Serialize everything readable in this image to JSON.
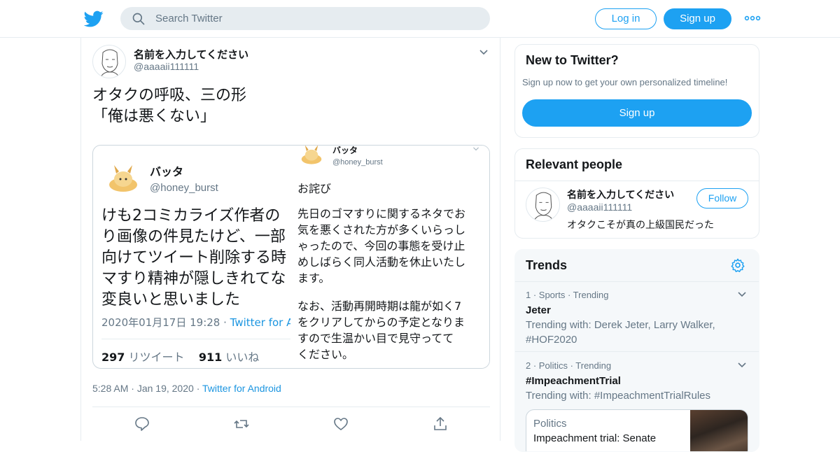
{
  "header": {
    "search_placeholder": "Search Twitter",
    "login_label": "Log in",
    "signup_label": "Sign up",
    "brand_color": "#1da1f2"
  },
  "tweet": {
    "name": "名前を入力してください",
    "handle": "@aaaaii111111",
    "text": "オタクの呼吸、三の形\n「俺は悪くない」",
    "time": "5:28 AM",
    "date": "Jan 19, 2020",
    "source": "Twitter for Android",
    "sep": "·"
  },
  "embedded": {
    "left": {
      "name": "バッタ",
      "handle": "@honey_burst",
      "body": "けも2コミカライズ作者の\nり画像の件見たけど、一部\n向けてツイート削除する時\nマすり精神が隠しきれてな\n変良いと思いました",
      "date": "2020年01月17日 19:28 ·",
      "source": "Twitter for And",
      "retweets": "297",
      "retweets_label": "リツイート",
      "likes": "911",
      "likes_label": "いいね"
    },
    "right": {
      "name": "バッタ",
      "handle": "@honey_burst",
      "title": "お詫び",
      "body1": "先日のゴマすりに関するネタでお\n気を悪くされた方が多くいらっし\nゃったので、今回の事態を受け止\nめしばらく同人活動を休止いたし\nます。",
      "body2": "なお、活動再開時期は龍が如く7\nをクリアしてからの予定となりま\nすので生温かい目で見守ってて\nください。"
    }
  },
  "sidebar": {
    "new_to_twitter": {
      "title": "New to Twitter?",
      "subtitle": "Sign up now to get your own personalized timeline!",
      "button": "Sign up"
    },
    "relevant": {
      "title": "Relevant people",
      "name": "名前を入力してください",
      "handle": "@aaaaii111111",
      "bio": "オタクこそが真の上級国民だった",
      "follow": "Follow"
    },
    "trends": {
      "title": "Trends",
      "items": [
        {
          "meta": "1 · Sports · Trending",
          "name": "Jeter",
          "with": "Trending with: Derek Jeter, Larry Walker,\n#HOF2020"
        },
        {
          "meta": "2 · Politics · Trending",
          "name": "#ImpeachmentTrial",
          "with": "Trending with: #ImpeachmentTrialRules"
        }
      ],
      "news": {
        "topic": "Politics",
        "headline": "Impeachment trial: Senate"
      }
    }
  }
}
